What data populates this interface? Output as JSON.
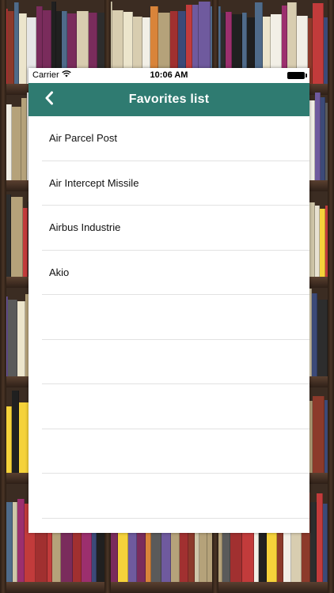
{
  "status_bar": {
    "carrier": "Carrier",
    "time": "10:06 AM"
  },
  "nav": {
    "title": "Favorites list",
    "back_icon": "chevron-left-icon"
  },
  "favorites": [
    "Air Parcel Post",
    "Air Intercept Missile",
    "Airbus Industrie",
    "Akio",
    "",
    "",
    "",
    "",
    ""
  ],
  "colors": {
    "nav_background": "#2f7b71",
    "nav_text": "#ffffff",
    "separator": "#e2e2e2"
  }
}
